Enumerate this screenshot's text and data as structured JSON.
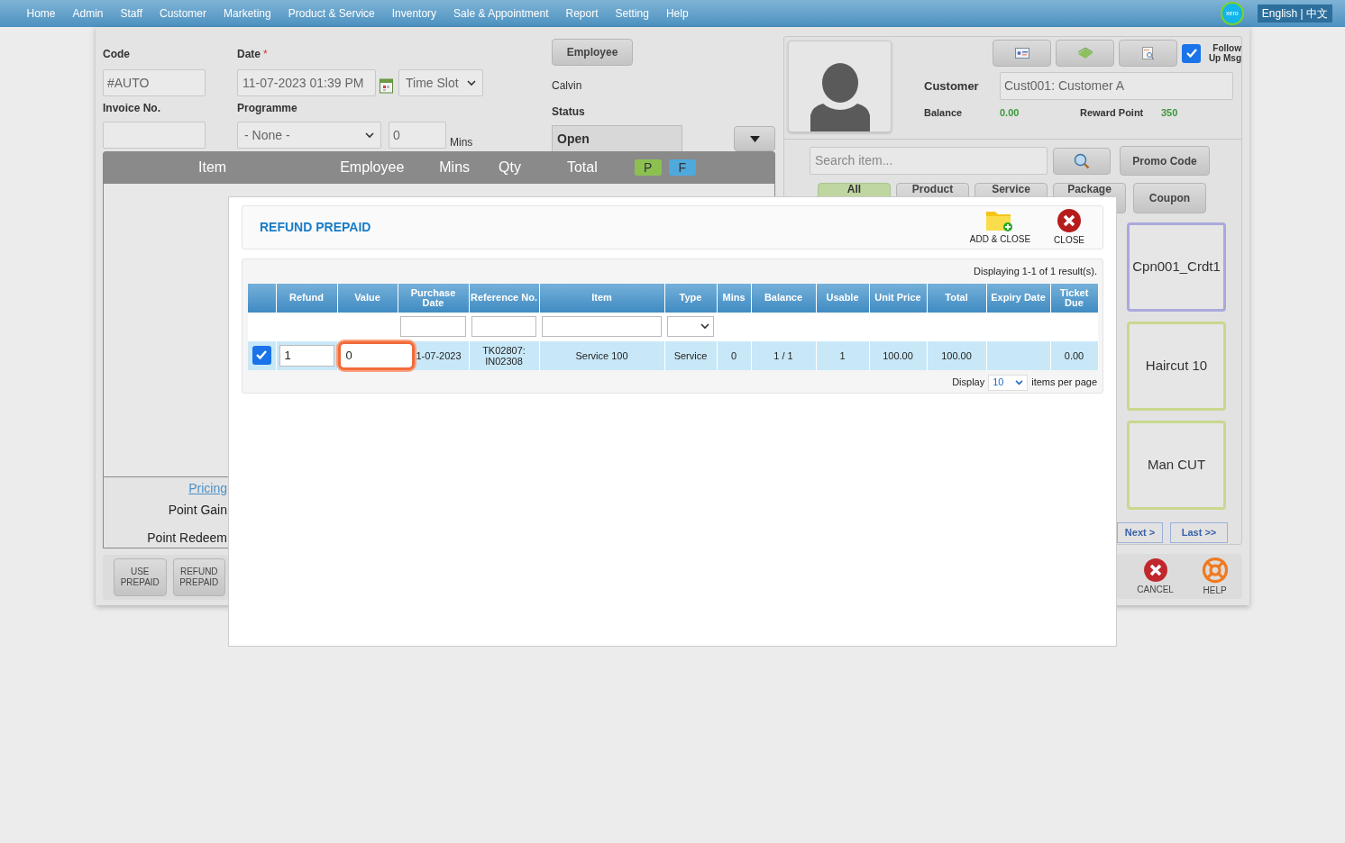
{
  "nav": {
    "items": [
      "Home",
      "Admin",
      "Staff",
      "Customer",
      "Marketing",
      "Product & Service",
      "Inventory",
      "Sale & Appointment",
      "Report",
      "Setting",
      "Help"
    ],
    "logo": "xero",
    "language": "English | 中文"
  },
  "form": {
    "code_label": "Code",
    "code_value": "#AUTO",
    "date_label": "Date",
    "required_mark": "*",
    "date_value": "11-07-2023 01:39 PM",
    "time_slot": "Time Slot",
    "employee_button": "Employee",
    "employee_name": "Calvin",
    "invoice_label": "Invoice No.",
    "programme_label": "Programme",
    "programme_value": "- None -",
    "mins_value": "0",
    "mins_unit": "Mins",
    "status_label": "Status",
    "status_value": "Open"
  },
  "cart": {
    "columns": [
      "Item",
      "Employee",
      "Mins",
      "Qty",
      "Total"
    ],
    "badges": [
      {
        "label": "P",
        "color": "#8cc152"
      },
      {
        "label": "F",
        "color": "#4fa9dd"
      }
    ],
    "pricing_link": "Pricing",
    "point_gain": "Point Gain",
    "point_redeem": "Point Redeem",
    "actions": [
      "USE PREPAID",
      "REFUND PREPAID"
    ]
  },
  "customer": {
    "follow_up": {
      "label": "Follow Up Msg",
      "checked": true
    },
    "label": "Customer",
    "value": "Cust001: Customer A",
    "balance_label": "Balance",
    "balance": "0.00",
    "reward_label": "Reward Point",
    "reward": "350"
  },
  "catalog": {
    "search_placeholder": "Search item...",
    "promo_button": "Promo Code",
    "tabs": [
      {
        "label": "All",
        "selected": true
      },
      {
        "label": "Product",
        "selected": false
      },
      {
        "label": "Service",
        "selected": false
      },
      {
        "label": "Package",
        "selected": false
      },
      {
        "label": "Coupon",
        "selected": false
      }
    ],
    "tiles": [
      {
        "label": "Cpn001_Crdt1",
        "color": "#a9a9dc"
      },
      {
        "label": "Haircut 10",
        "color": "#c9d88e"
      },
      {
        "label": "Man CUT",
        "color": "#c9d88e"
      }
    ],
    "pager": [
      "Next >",
      "Last >>"
    ],
    "cancel": "CANCEL",
    "help": "HELP"
  },
  "modal": {
    "title": "REFUND PREPAID",
    "add_close": "ADD & CLOSE",
    "close": "CLOSE",
    "result_info": "Displaying 1-1 of 1 result(s).",
    "columns": [
      "Refund",
      "Value",
      "Purchase Date",
      "Reference No.",
      "Item",
      "Type",
      "Mins",
      "Balance",
      "Usable",
      "Unit Price",
      "Total",
      "Expiry Date",
      "Ticket Due"
    ],
    "rows": [
      {
        "checked": true,
        "refund": "1",
        "value": "0",
        "purchase_date": "1-07-2023",
        "reference": "TK02807: IN02308",
        "item": "Service 100",
        "type": "Service",
        "mins": "0",
        "balance": "1 / 1",
        "usable": "1",
        "unit_price": "100.00",
        "total": "100.00",
        "ticket_due": "0.00"
      }
    ],
    "display_label": "Display",
    "page_size": "10",
    "per_page_label": "items per page"
  }
}
